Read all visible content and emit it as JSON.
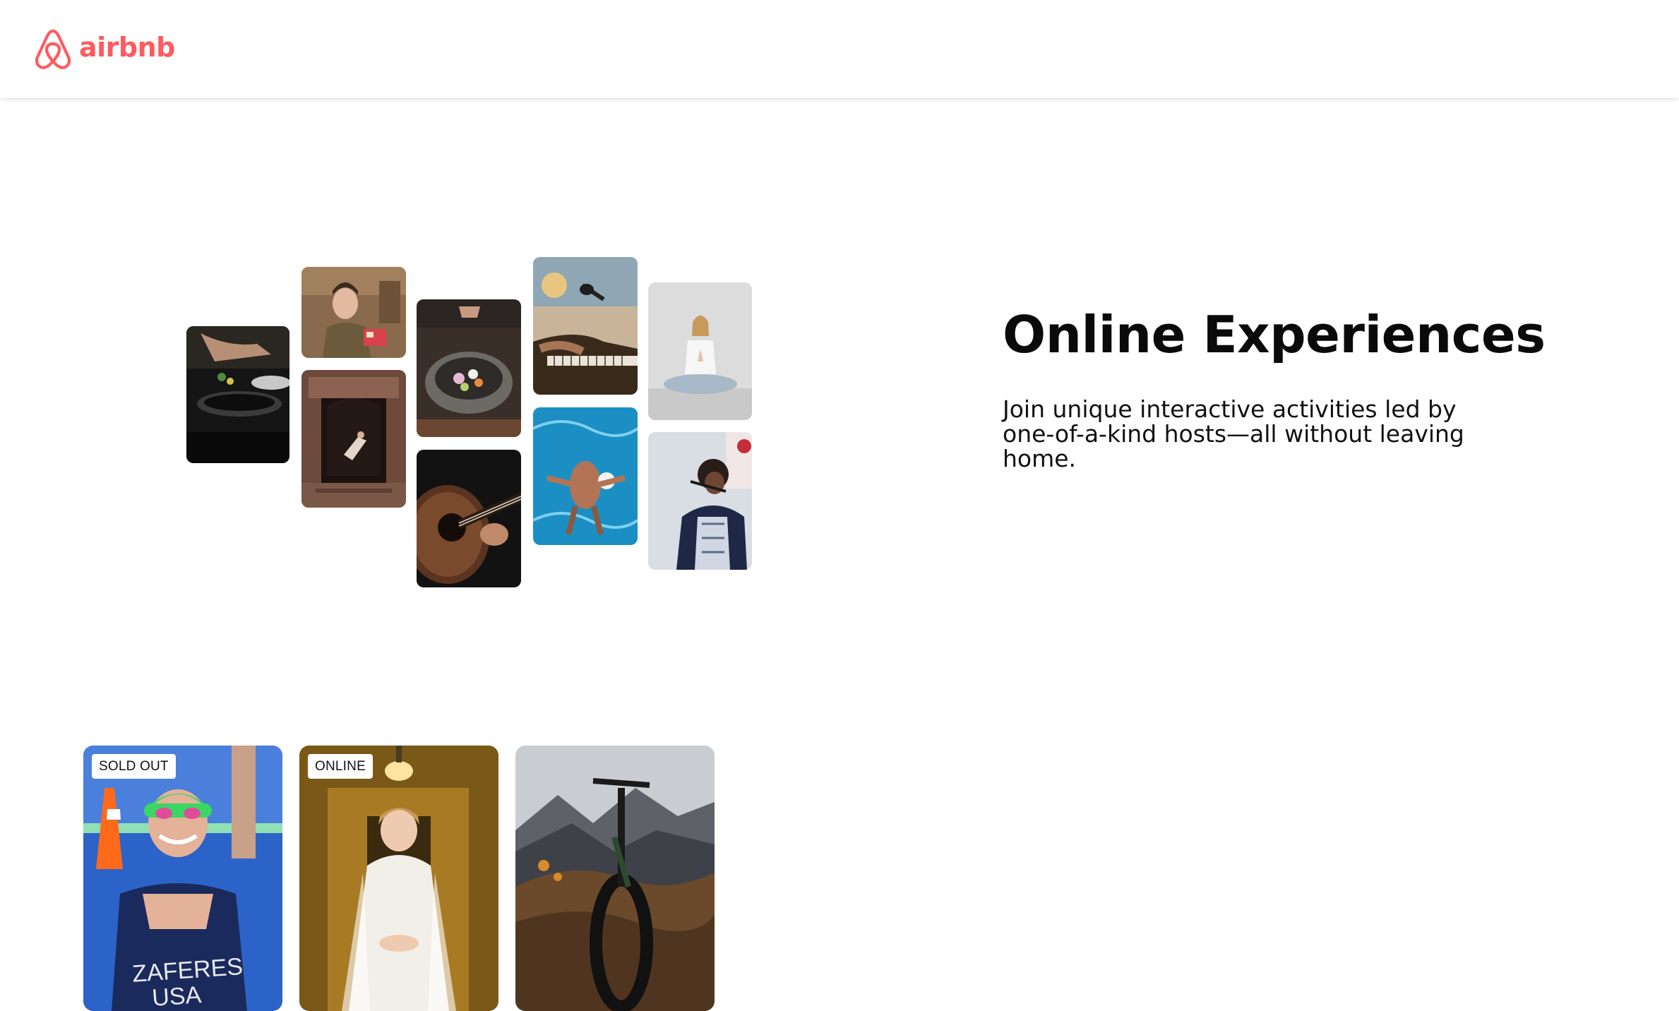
{
  "brand": {
    "name": "airbnb",
    "color": "#FF5A5F"
  },
  "hero": {
    "title": "Online Experiences",
    "subtitle": "Join unique interactive activities led by one-of-a-kind hosts—all without leaving home.",
    "photos": [
      {
        "name": "cooking-pans-photo"
      },
      {
        "name": "host-holding-cards-photo"
      },
      {
        "name": "dancer-doorway-photo"
      },
      {
        "name": "garnish-bowl-photo"
      },
      {
        "name": "guitar-player-photo"
      },
      {
        "name": "piano-microphone-photo"
      },
      {
        "name": "swimmer-pool-photo"
      },
      {
        "name": "meditation-photo"
      },
      {
        "name": "singer-microphone-photo"
      }
    ]
  },
  "cards": [
    {
      "badge": "SOLD OUT",
      "photo": "triathlete-photo",
      "caption_on_image": "ZAFERES USA"
    },
    {
      "badge": "ONLINE",
      "photo": "bride-photo"
    },
    {
      "badge": "",
      "photo": "mountain-bike-photo"
    }
  ]
}
